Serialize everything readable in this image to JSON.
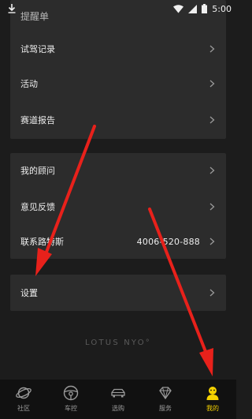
{
  "status_bar": {
    "time": "5:00",
    "icons": [
      "download-icon",
      "wifi-icon",
      "signal-icon",
      "battery-icon"
    ]
  },
  "partial_header": {
    "text": "提醒单"
  },
  "card1": {
    "items": [
      {
        "label": "试驾记录"
      },
      {
        "label": "活动"
      },
      {
        "label": "赛道报告"
      }
    ]
  },
  "card2": {
    "items": [
      {
        "label": "我的顾问"
      },
      {
        "label": "意见反馈"
      },
      {
        "label": "联系路特斯",
        "value": "4006-520-888"
      }
    ]
  },
  "card3": {
    "items": [
      {
        "label": "设置"
      }
    ]
  },
  "brand": {
    "text": "LOTUS NYO°"
  },
  "bottom_nav": {
    "items": [
      {
        "label": "社区",
        "icon": "planet-icon",
        "active": false
      },
      {
        "label": "车控",
        "icon": "steering-wheel-icon",
        "active": false
      },
      {
        "label": "选购",
        "icon": "car-icon",
        "active": false
      },
      {
        "label": "服务",
        "icon": "diamond-icon",
        "active": false
      },
      {
        "label": "我的",
        "icon": "user-icon",
        "active": true
      }
    ]
  },
  "colors": {
    "background": "#1c1c1c",
    "card": "#2c2c2c",
    "accent": "#f5d200",
    "arrow": "#e8211b"
  }
}
